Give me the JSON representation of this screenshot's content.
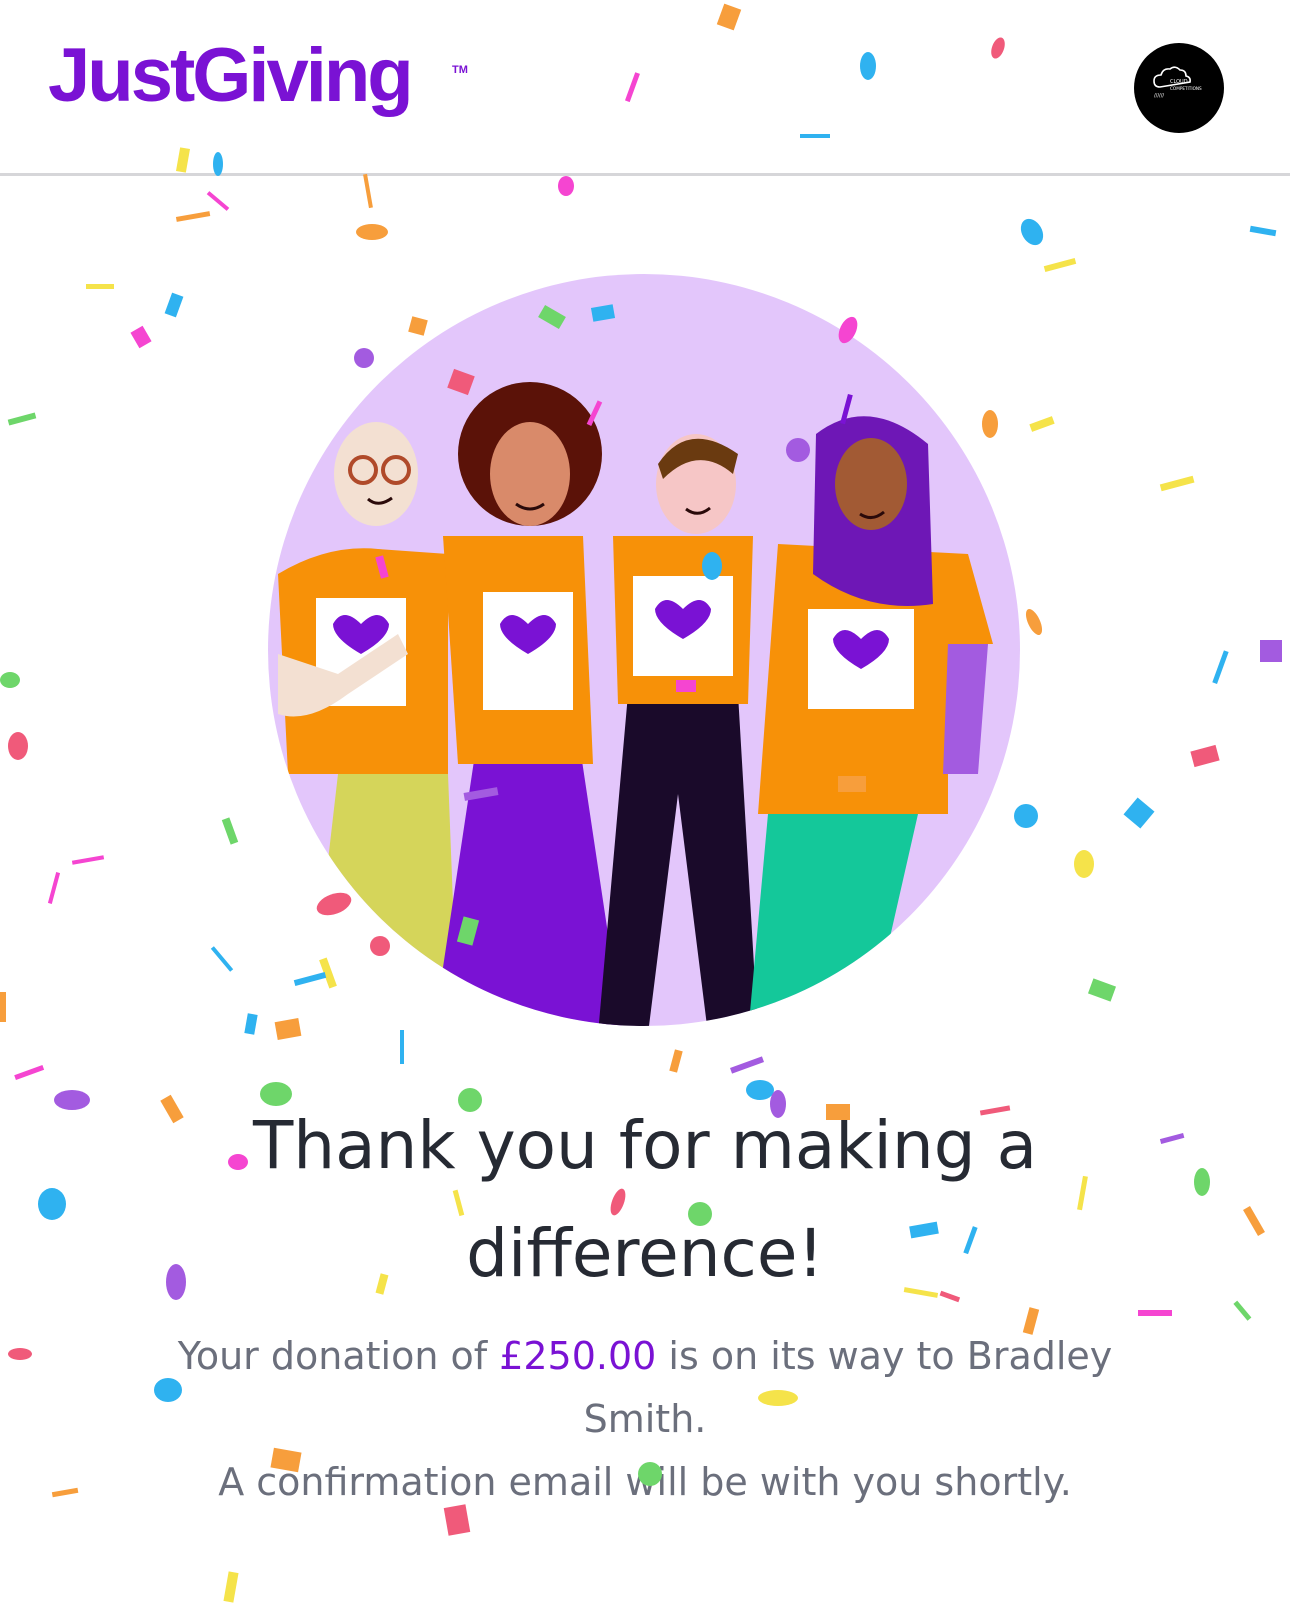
{
  "header": {
    "logo_text": "JustGiving",
    "logo_tm": "TM",
    "avatar_text_top": "CLOUD",
    "avatar_text_mid": "COMPETITIONS",
    "avatar_text_bottom": "////// ",
    "avatar_alt": "account avatar"
  },
  "colors": {
    "brand": "#7a12d4",
    "heading": "#262a33",
    "body_text": "#6b6f7c",
    "illustration_bg": "#e3c6fb",
    "shirt": "#f79108"
  },
  "main": {
    "heading_line1": "Thank you for making a",
    "heading_line2": "difference!",
    "message_prefix": "Your donation of ",
    "amount": "£250.00",
    "message_suffix": " is on its way to Bradley",
    "recipient_tail": "Smith.",
    "confirmation": "A confirmation email will be with you shortly."
  }
}
